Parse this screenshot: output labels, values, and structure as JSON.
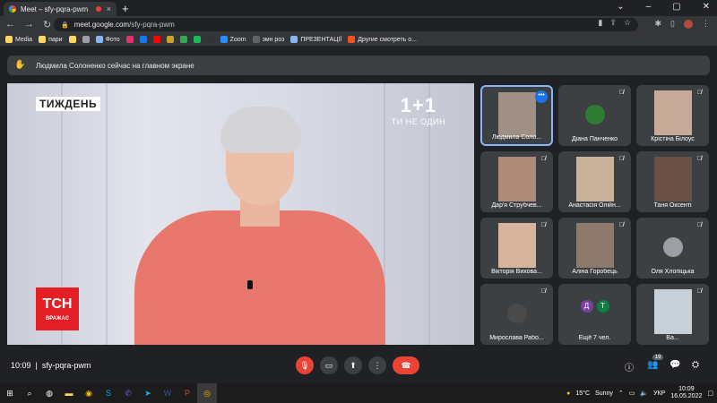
{
  "browser": {
    "tab_title": "Meet – sfy-pqra-pwm",
    "tab_close": "×",
    "new_tab": "+",
    "window_controls": [
      "⌄",
      "–",
      "▢",
      "✕"
    ],
    "url_host": "meet.google.com",
    "url_path": "/sfy-pqra-pwm"
  },
  "bookmarks": [
    {
      "label": "Media",
      "color": "#fdd663"
    },
    {
      "label": "пари",
      "color": "#fdd663"
    },
    {
      "label": "",
      "color": "#fdd663"
    },
    {
      "label": "",
      "color": "#9aa0a6"
    },
    {
      "label": "Фото",
      "color": "#8ab4f8"
    },
    {
      "label": "",
      "color": "#e1306c"
    },
    {
      "label": "",
      "color": "#1877f2"
    },
    {
      "label": "",
      "color": "#ff0000"
    },
    {
      "label": "",
      "color": "#c9a227"
    },
    {
      "label": "",
      "color": "#34a853"
    },
    {
      "label": "",
      "color": "#1db954"
    },
    {
      "label": "",
      "color": "#333333"
    },
    {
      "label": "Zoom",
      "color": "#2d8cff"
    },
    {
      "label": "змн роз",
      "color": "#5f6368"
    },
    {
      "label": "ПРЕЗЕНТАЦІЇ",
      "color": "#8ab4f8"
    },
    {
      "label": "Другие смотреть о...",
      "color": "#f4511e"
    }
  ],
  "banner": {
    "text": "Людмила Солоненко сейчас на главном экране"
  },
  "main_video": {
    "channel_label": "ТИЖДЕНЬ",
    "logo_big": "1+1",
    "logo_small": "ТИ НЕ ОДИН",
    "tsn_title": "ТСН",
    "tsn_sub": "ВРАЖАЄ"
  },
  "participants": [
    {
      "name": "Людмила Соло...",
      "kind": "photo",
      "color": "#a08f84",
      "active": true
    },
    {
      "name": "Діана Панченко",
      "kind": "avatar",
      "color": "#2e7d32",
      "active": false
    },
    {
      "name": "Крістіна Білоус",
      "kind": "photo",
      "color": "#c7a99a",
      "active": false
    },
    {
      "name": "Дар'я Струбчев...",
      "kind": "photo",
      "color": "#b08a78",
      "active": false
    },
    {
      "name": "Анастасія Олійн...",
      "kind": "photo",
      "color": "#c9b39a",
      "active": false
    },
    {
      "name": "Таня Оксенті",
      "kind": "photo",
      "color": "#6b5048",
      "active": false
    },
    {
      "name": "Вікторія Вихова...",
      "kind": "photo",
      "color": "#d8b49e",
      "active": false
    },
    {
      "name": "Аліна Горобець",
      "kind": "photo",
      "color": "#8d7a6d",
      "active": false
    },
    {
      "name": "Оля Хлопіцька",
      "kind": "avatar",
      "color": "#9aa0a6",
      "active": false
    },
    {
      "name": "Мирослава Рабо...",
      "kind": "avatar",
      "color": "#4a4a4a",
      "active": false
    },
    {
      "name": "Ещё 7 чел.",
      "kind": "more",
      "color": "#3c4043",
      "active": false
    },
    {
      "name": "Ва...",
      "kind": "photo",
      "color": "#c8d0d8",
      "active": false
    }
  ],
  "more_people": {
    "initials": [
      "Д",
      "Т"
    ],
    "colors": [
      "#7b3fa0",
      "#0b8043"
    ]
  },
  "controls": {
    "time": "10:09",
    "meeting_code": "sfy-pqra-pwm",
    "people_count": "19"
  },
  "taskbar": {
    "weather_temp": "15°C",
    "weather_text": "Sunny",
    "lang": "УКР",
    "time": "10:09",
    "date": "16.05.2022"
  }
}
